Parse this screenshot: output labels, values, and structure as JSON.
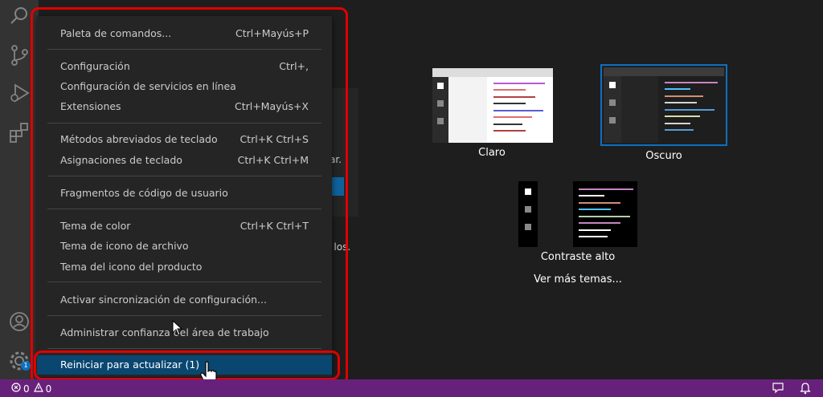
{
  "menu": {
    "items": [
      {
        "label": "Paleta de comandos...",
        "key": "Ctrl+Mayús+P"
      },
      {
        "label": "Configuración",
        "key": "Ctrl+,"
      },
      {
        "label": "Configuración de servicios en línea",
        "key": ""
      },
      {
        "label": "Extensiones",
        "key": "Ctrl+Mayús+X"
      },
      {
        "label": "Métodos abreviados de teclado",
        "key": "Ctrl+K Ctrl+S"
      },
      {
        "label": "Asignaciones de teclado",
        "key": "Ctrl+K Ctrl+M"
      },
      {
        "label": "Fragmentos de código de usuario",
        "key": ""
      },
      {
        "label": "Tema de color",
        "key": "Ctrl+K Ctrl+T"
      },
      {
        "label": "Tema de icono de archivo",
        "key": ""
      },
      {
        "label": "Tema del icono del producto",
        "key": ""
      },
      {
        "label": "Activar sincronización de configuración...",
        "key": ""
      },
      {
        "label": "Administrar confianza del área de trabajo",
        "key": ""
      },
      {
        "label": "Reiniciar para actualizar (1)",
        "key": ""
      }
    ]
  },
  "background": {
    "text_ar": "ar.",
    "text_los": "os los."
  },
  "themes": {
    "claro": "Claro",
    "oscuro": "Oscuro",
    "contraste": "Contraste alto",
    "ver_mas": "Ver más temas..."
  },
  "activity": {
    "badge": "1",
    "icons": [
      "search-icon",
      "source-control-icon",
      "run-debug-icon",
      "extensions-icon",
      "account-icon",
      "gear-icon"
    ]
  },
  "status": {
    "errors": "0",
    "warnings": "0"
  },
  "colors": {
    "accent": "#0e70c0",
    "status_bar": "#68217a",
    "highlight": "#e00000",
    "selected_item": "#094771"
  }
}
